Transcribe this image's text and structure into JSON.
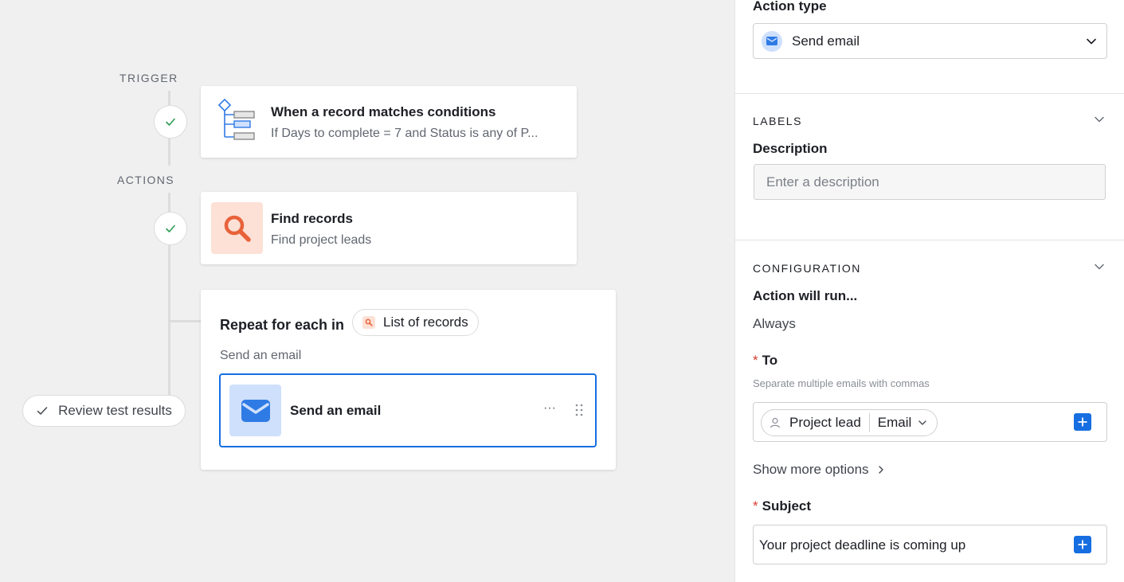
{
  "canvas": {
    "trigger_label": "TRIGGER",
    "actions_label": "ACTIONS",
    "trigger_card": {
      "title": "When a record matches conditions",
      "subtitle": "If Days to complete = 7 and Status is any of P..."
    },
    "find_card": {
      "title": "Find records",
      "subtitle": "Find project leads"
    },
    "repeat_card": {
      "title": "Repeat for each in",
      "pill_label": "List of records",
      "subtitle": "Send an email",
      "email_step": {
        "title": "Send an email",
        "more_label": "···",
        "drag_label": "⋮⋮"
      }
    },
    "review_button": "Review test results"
  },
  "panel": {
    "action_type_label": "Action type",
    "action_type_value": "Send email",
    "labels_section": "LABELS",
    "description_label": "Description",
    "description_placeholder": "Enter a description",
    "configuration_section": "CONFIGURATION",
    "action_will_run_label": "Action will run...",
    "action_will_run_value": "Always",
    "required_mark": "*",
    "to_label": "To",
    "to_help": "Separate multiple emails with commas",
    "to_token": {
      "field": "Project lead",
      "subfield": "Email"
    },
    "show_more_options": "Show more options",
    "subject_label": "Subject",
    "subject_value": "Your project deadline is coming up"
  },
  "colors": {
    "accent_blue": "#166ee1",
    "check_green": "#2d9c52",
    "find_icon_bg": "#fde1d6",
    "find_icon_fg": "#e8623a",
    "email_icon_bg": "#cfe0fc",
    "required_red": "#d63b2f"
  }
}
